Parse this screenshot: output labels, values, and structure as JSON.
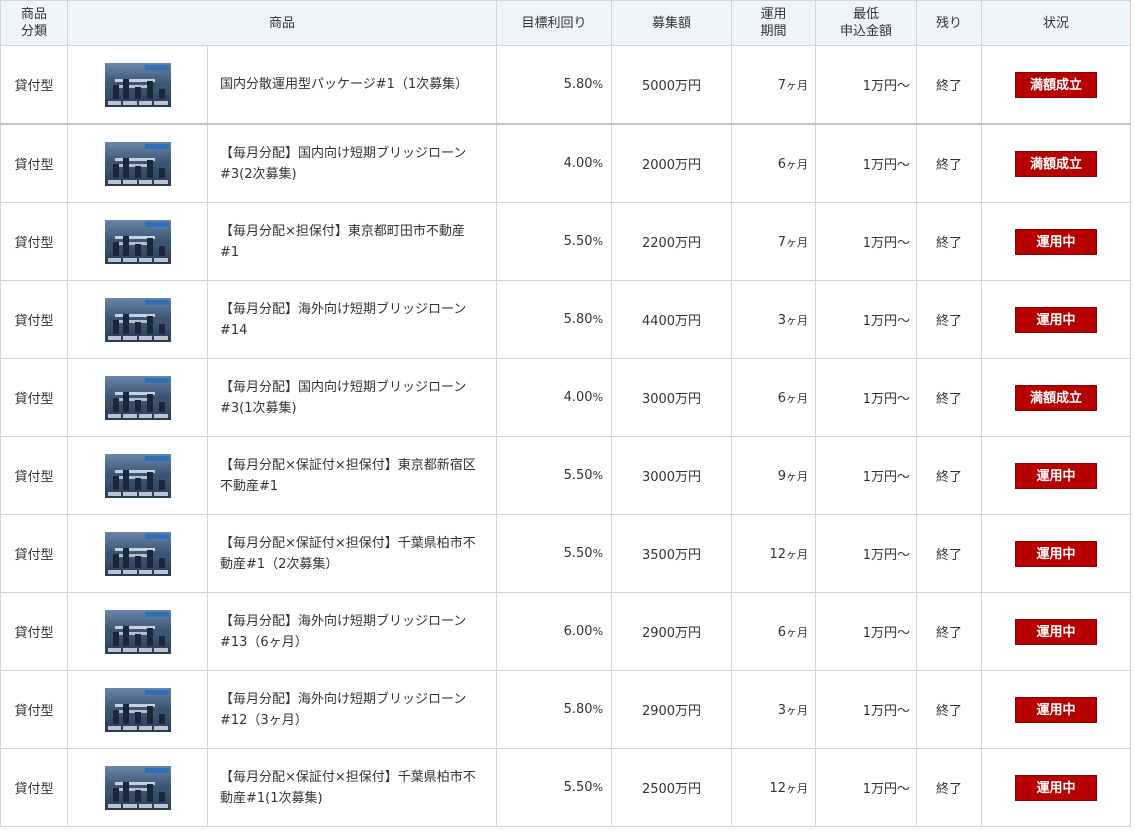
{
  "headers": {
    "category": "商品\n分類",
    "product": "商品",
    "target_yield": "目標利回り",
    "amount": "募集額",
    "period": "運用\n期間",
    "min_amount": "最低\n申込金額",
    "remaining": "残り",
    "status": "状況"
  },
  "rows": [
    {
      "category": "貸付型",
      "name": "国内分散運用型パッケージ#1（1次募集）",
      "rate": "5.80",
      "rate_unit": "%",
      "amount": "5000万円",
      "period_num": "7",
      "period_unit": "ヶ月",
      "min": "1万円～",
      "remaining": "終了",
      "status": "満額成立"
    },
    {
      "category": "貸付型",
      "name": "【毎月分配】国内向け短期ブリッジローン#3(2次募集)",
      "rate": "4.00",
      "rate_unit": "%",
      "amount": "2000万円",
      "period_num": "6",
      "period_unit": "ヶ月",
      "min": "1万円～",
      "remaining": "終了",
      "status": "満額成立"
    },
    {
      "category": "貸付型",
      "name": "【毎月分配×担保付】東京都町田市不動産#1",
      "rate": "5.50",
      "rate_unit": "%",
      "amount": "2200万円",
      "period_num": "7",
      "period_unit": "ヶ月",
      "min": "1万円～",
      "remaining": "終了",
      "status": "運用中"
    },
    {
      "category": "貸付型",
      "name": "【毎月分配】海外向け短期ブリッジローン#14",
      "rate": "5.80",
      "rate_unit": "%",
      "amount": "4400万円",
      "period_num": "3",
      "period_unit": "ヶ月",
      "min": "1万円～",
      "remaining": "終了",
      "status": "運用中"
    },
    {
      "category": "貸付型",
      "name": "【毎月分配】国内向け短期ブリッジローン#3(1次募集)",
      "rate": "4.00",
      "rate_unit": "%",
      "amount": "3000万円",
      "period_num": "6",
      "period_unit": "ヶ月",
      "min": "1万円～",
      "remaining": "終了",
      "status": "満額成立"
    },
    {
      "category": "貸付型",
      "name": "【毎月分配×保証付×担保付】東京都新宿区不動産#1",
      "rate": "5.50",
      "rate_unit": "%",
      "amount": "3000万円",
      "period_num": "9",
      "period_unit": "ヶ月",
      "min": "1万円～",
      "remaining": "終了",
      "status": "運用中"
    },
    {
      "category": "貸付型",
      "name": "【毎月分配×保証付×担保付】千葉県柏市不動産#1（2次募集）",
      "rate": "5.50",
      "rate_unit": "%",
      "amount": "3500万円",
      "period_num": "12",
      "period_unit": "ヶ月",
      "min": "1万円～",
      "remaining": "終了",
      "status": "運用中"
    },
    {
      "category": "貸付型",
      "name": "【毎月分配】海外向け短期ブリッジローン#13（6ヶ月）",
      "rate": "6.00",
      "rate_unit": "%",
      "amount": "2900万円",
      "period_num": "6",
      "period_unit": "ヶ月",
      "min": "1万円～",
      "remaining": "終了",
      "status": "運用中"
    },
    {
      "category": "貸付型",
      "name": "【毎月分配】海外向け短期ブリッジローン#12（3ヶ月）",
      "rate": "5.80",
      "rate_unit": "%",
      "amount": "2900万円",
      "period_num": "3",
      "period_unit": "ヶ月",
      "min": "1万円～",
      "remaining": "終了",
      "status": "運用中"
    },
    {
      "category": "貸付型",
      "name": "【毎月分配×保証付×担保付】千葉県柏市不動産#1(1次募集)",
      "rate": "5.50",
      "rate_unit": "%",
      "amount": "2500万円",
      "period_num": "12",
      "period_unit": "ヶ月",
      "min": "1万円～",
      "remaining": "終了",
      "status": "運用中"
    }
  ],
  "colors": {
    "status_badge": "#b70000",
    "header_bg": "#eef4fb",
    "border": "#cfd6df"
  },
  "icons": {
    "thumbnail": "fund-thumbnail-image"
  }
}
